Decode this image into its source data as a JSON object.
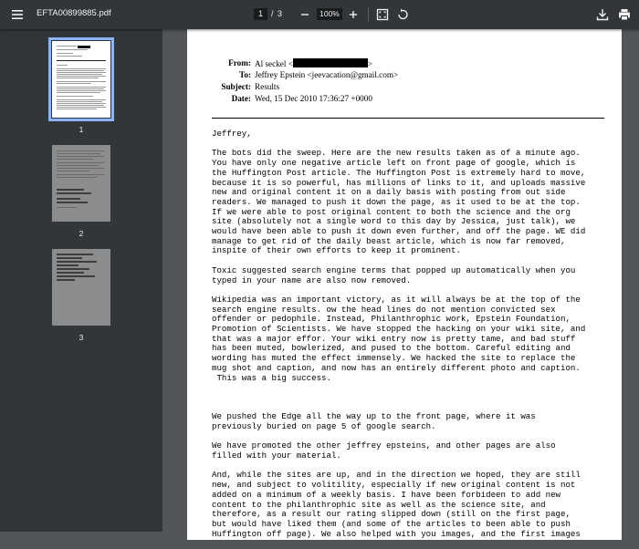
{
  "toolbar": {
    "menu_icon": "hamburger-menu-icon",
    "title": "EFTA00899885.pdf",
    "current_page": "1",
    "page_separator": "/",
    "total_pages": "3",
    "zoom": "100%",
    "zoom_out_icon": "minus-icon",
    "zoom_in_icon": "plus-icon",
    "fit_icon": "fit-to-page-icon",
    "rotate_icon": "rotate-icon",
    "download_icon": "download-icon",
    "print_icon": "print-icon"
  },
  "sidebar": {
    "thumbnails": [
      {
        "label": "1"
      },
      {
        "label": "2"
      },
      {
        "label": "3"
      }
    ]
  },
  "email": {
    "from_label": "From:",
    "from_value": "Al seckel <",
    "from_tail": ">",
    "to_label": "To:",
    "to_value": "Jeffrey Epstein <jeevacation@gmail.com>",
    "subject_label": "Subject:",
    "subject_value": "Results",
    "date_label": "Date:",
    "date_value": "Wed, 15 Dec 2010 17:36:27 +0000"
  },
  "body": {
    "greeting": "Jeffrey,",
    "p1": "The bots did the sweep. Here are the new results taken as of a minute ago.\nYou have only one negative article left on front page of google, which is\nthe Huffington Post article. The Huffington Post is extremely hard to move,\nbecause it is so powerful, has millions of links to it, and uploads massive\nnew and original content it on a daily basis with posting from out side\nreaders. We managed to push it down the page, as it used to be at the top.\nIf we were able to post original content to both the science and the org\nsite (absolutely not a single word to this day by Jessica, just talk), we\nwould have been able to push it down even further, and off the page. WE did\nmanage to get rid of the daily beast article, which is now far removed,\ninspite of their own efforts to keep it prominent.",
    "p2": "Toxic suggested search engine terms that popped up automatically when you\ntyped in your name are also now removed.",
    "p3": "Wikipedia was an important victory, as it will always be at the top of the\nsearch engine results. ow the head lines do not mention convicted sex\noffender or pedophile. Instead, Philanthrophic work, Epstein Foundation,\nPromotion of Scientists. We have stopped the hacking on your wiki site, and\nthat was a major effor. Your wiki entry now is pretty tame, and bad stuff\nhas been muted, bowlerized, and pused to the bottom. Careful editing and\nwording has muted the effect immensely. We hacked the site to replace the\nmug shot and caption, and now has an entirely different photo and caption.\n This was a big success.",
    "p4": "We pushed the Edge all the way up to the front page, where it was\npreviously buried on page 5 of google search.",
    "p5": "We have promoted the other jeffrey epsteins, and other pages are also\nfilled with your material.",
    "p6": "And, while the sites are up, and in the direction we hoped, they are still\nnew, and subject to volitility, especially if new original content is not\nadded on a minimum of a weekly basis. I have been forbideen to add new\ncontent to the philanthrophic site as well as the science site, and\ntherefore, as a result our rating slipped down (still on the first page,\nbut would have liked them (and some of the articles to been able to push\nHuffington off page). We also helped with you images, and the first images"
  }
}
